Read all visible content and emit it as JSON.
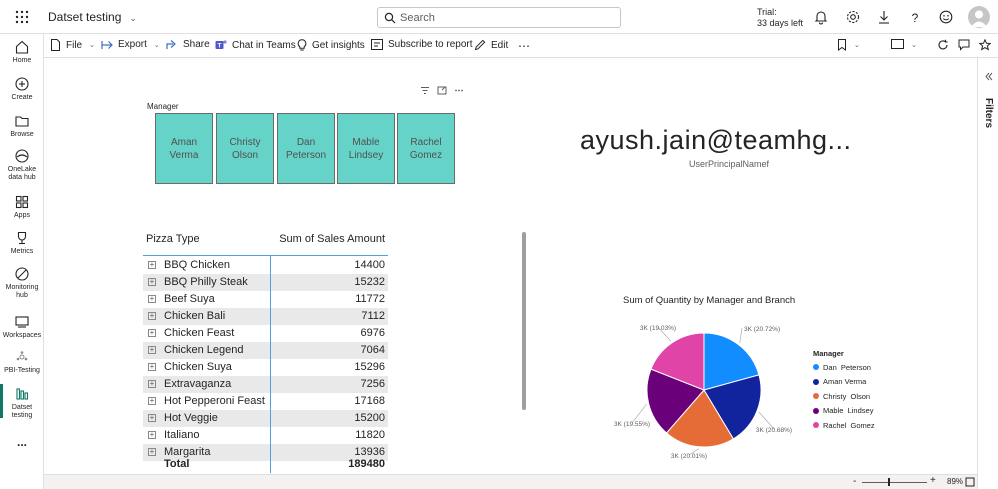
{
  "topbar": {
    "app_title": "Datset testing",
    "search_placeholder": "Search",
    "trial_line1": "Trial:",
    "trial_line2": "33 days left"
  },
  "nav": {
    "items": [
      {
        "label": "Home",
        "icon": "home-icon"
      },
      {
        "label": "Create",
        "icon": "create-icon"
      },
      {
        "label": "Browse",
        "icon": "browse-icon"
      },
      {
        "label1": "OneLake",
        "label2": "data hub",
        "icon": "onelake-icon"
      },
      {
        "label": "Apps",
        "icon": "apps-icon"
      },
      {
        "label": "Metrics",
        "icon": "trophy-icon"
      },
      {
        "label1": "Monitoring",
        "label2": "hub",
        "icon": "monitoring-icon"
      },
      {
        "label": "Workspaces",
        "icon": "workspaces-icon"
      },
      {
        "label": "PBI-Testing",
        "icon": "workspace-icon"
      },
      {
        "label1": "Datset",
        "label2": "testing",
        "icon": "report-icon"
      }
    ],
    "more": "..."
  },
  "toolbar": {
    "file": "File",
    "export": "Export",
    "share": "Share",
    "chat": "Chat in Teams",
    "insights": "Get insights",
    "subscribe": "Subscribe to report",
    "edit": "Edit",
    "more": "⋯"
  },
  "right_panel": {
    "filters": "Filters"
  },
  "slicer": {
    "title": "Manager",
    "tiles": [
      {
        "line1": "Aman",
        "line2": "Verma"
      },
      {
        "line1": "Christy",
        "line2": "Olson"
      },
      {
        "line1": "Dan",
        "line2": "Peterson"
      },
      {
        "line1": "Mable",
        "line2": "Lindsey"
      },
      {
        "line1": "Rachel",
        "line2": "Gomez"
      }
    ]
  },
  "card": {
    "value": "ayush.jain@teamhg...",
    "label": "UserPrincipalNamef"
  },
  "matrix": {
    "col1": "Pizza Type",
    "col2": "Sum of Sales Amount",
    "rows": [
      {
        "name": "BBQ Chicken",
        "value": "14400"
      },
      {
        "name": "BBQ Philly Steak",
        "value": "15232"
      },
      {
        "name": "Beef Suya",
        "value": "11772"
      },
      {
        "name": "Chicken Bali",
        "value": "7112"
      },
      {
        "name": "Chicken Feast",
        "value": "6976"
      },
      {
        "name": "Chicken Legend",
        "value": "7064"
      },
      {
        "name": "Chicken Suya",
        "value": "15296"
      },
      {
        "name": "Extravaganza",
        "value": "7256"
      },
      {
        "name": "Hot Pepperoni Feast",
        "value": "17168"
      },
      {
        "name": "Hot Veggie",
        "value": "15200"
      },
      {
        "name": "Italiano",
        "value": "11820"
      },
      {
        "name": "Margarita",
        "value": "13936"
      }
    ],
    "total_label": "Total",
    "total_value": "189480"
  },
  "chart_data": {
    "type": "pie",
    "title": "Sum of Quantity by Manager and Branch",
    "legend_title": "Manager",
    "legend_placement": "right",
    "slices": [
      {
        "name": "Dan  Peterson",
        "value": 20.72,
        "color": "#118dff",
        "label": "3K (20.72%)"
      },
      {
        "name": "Aman Verma",
        "value": 20.68,
        "color": "#12239e",
        "label": "3K (20.68%)"
      },
      {
        "name": "Christy  Olson",
        "value": 20.01,
        "color": "#e66c37",
        "label": "3K (20.01%)"
      },
      {
        "name": "Mable  Lindsey",
        "value": 19.55,
        "color": "#6b007b",
        "label": "3K (19.55%)"
      },
      {
        "name": "Rachel  Gomez",
        "value": 19.03,
        "color": "#e044a7",
        "label": "3K (19.03%)"
      }
    ]
  },
  "status": {
    "zoom": "89%"
  }
}
